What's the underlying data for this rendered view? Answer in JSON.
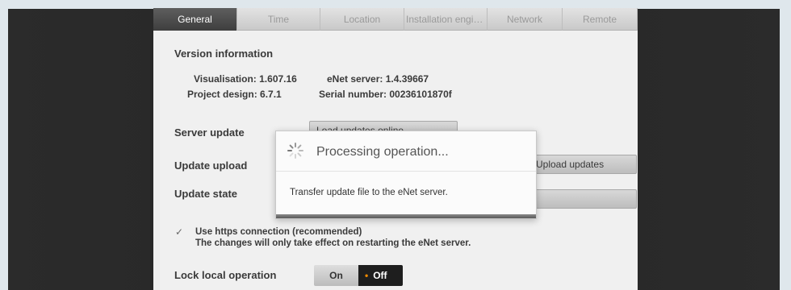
{
  "tabs": [
    {
      "label": "General",
      "active": true
    },
    {
      "label": "Time",
      "active": false
    },
    {
      "label": "Location",
      "active": false
    },
    {
      "label": "Installation engine...",
      "active": false
    },
    {
      "label": "Network",
      "active": false
    },
    {
      "label": "Remote",
      "active": false
    }
  ],
  "version": {
    "title": "Version information",
    "visualisation": "Visualisation: 1.607.16",
    "enet_server": "eNet server: 1.4.39667",
    "project_design": "Project design: 6.7.1",
    "serial_number": "Serial number: 00236101870f"
  },
  "server_update": {
    "label": "Server update",
    "button_label": "Load updates online"
  },
  "update_upload": {
    "label": "Update upload",
    "button_label": "Upload updates"
  },
  "update_state": {
    "label": "Update state",
    "value": ""
  },
  "https": {
    "checked": true,
    "line1": "Use https connection (recommended)",
    "line2": "The changes will only take effect on restarting the eNet server."
  },
  "lock_local": {
    "label": "Lock local operation",
    "on_label": "On",
    "off_label": "Off",
    "selected": "Off"
  },
  "dialog": {
    "title": "Processing operation...",
    "message": "Transfer update file to the eNet server."
  },
  "colors": {
    "accent": "#f08a00",
    "tab_active": "#4a4a4a"
  }
}
